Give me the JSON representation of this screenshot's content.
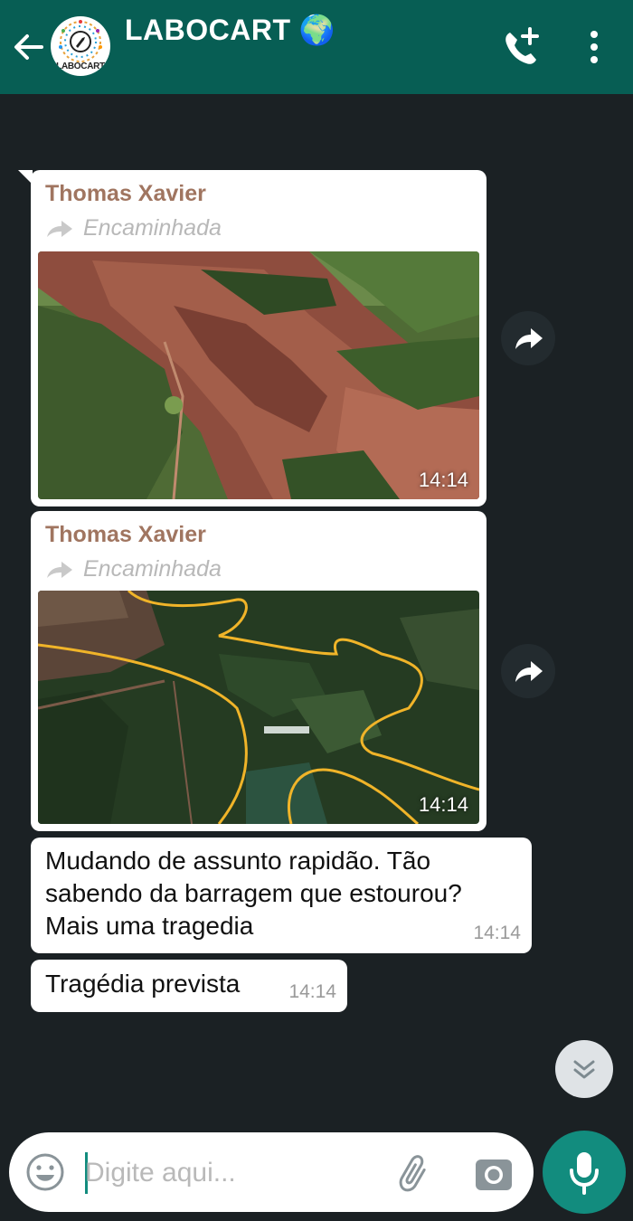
{
  "header": {
    "title": "LABOCART",
    "title_emoji": "🌍",
    "avatar_text": "LABOCART",
    "back_icon": "arrow-left-icon",
    "add_call_icon": "phone-plus-icon",
    "menu_icon": "more-vertical-icon"
  },
  "messages": [
    {
      "sender": "Thomas Xavier",
      "forwarded_label": "Encaminhada",
      "type": "image",
      "time": "14:14"
    },
    {
      "sender": "Thomas Xavier",
      "forwarded_label": "Encaminhada",
      "type": "image",
      "time": "14:14"
    },
    {
      "type": "text",
      "lines": [
        "Mudando de assunto rapidão. Tão",
        "sabendo da barragem que estourou?",
        "Mais uma tragedia"
      ],
      "time": "14:14"
    },
    {
      "type": "text",
      "lines": [
        "Tragédia prevista"
      ],
      "time": "14:14"
    }
  ],
  "composer": {
    "placeholder": "Digite aqui...",
    "value": ""
  },
  "colors": {
    "header_bg": "#075e54",
    "chat_bg": "#1b2124",
    "accent": "#128c7e",
    "sender_name": "#a07560"
  }
}
